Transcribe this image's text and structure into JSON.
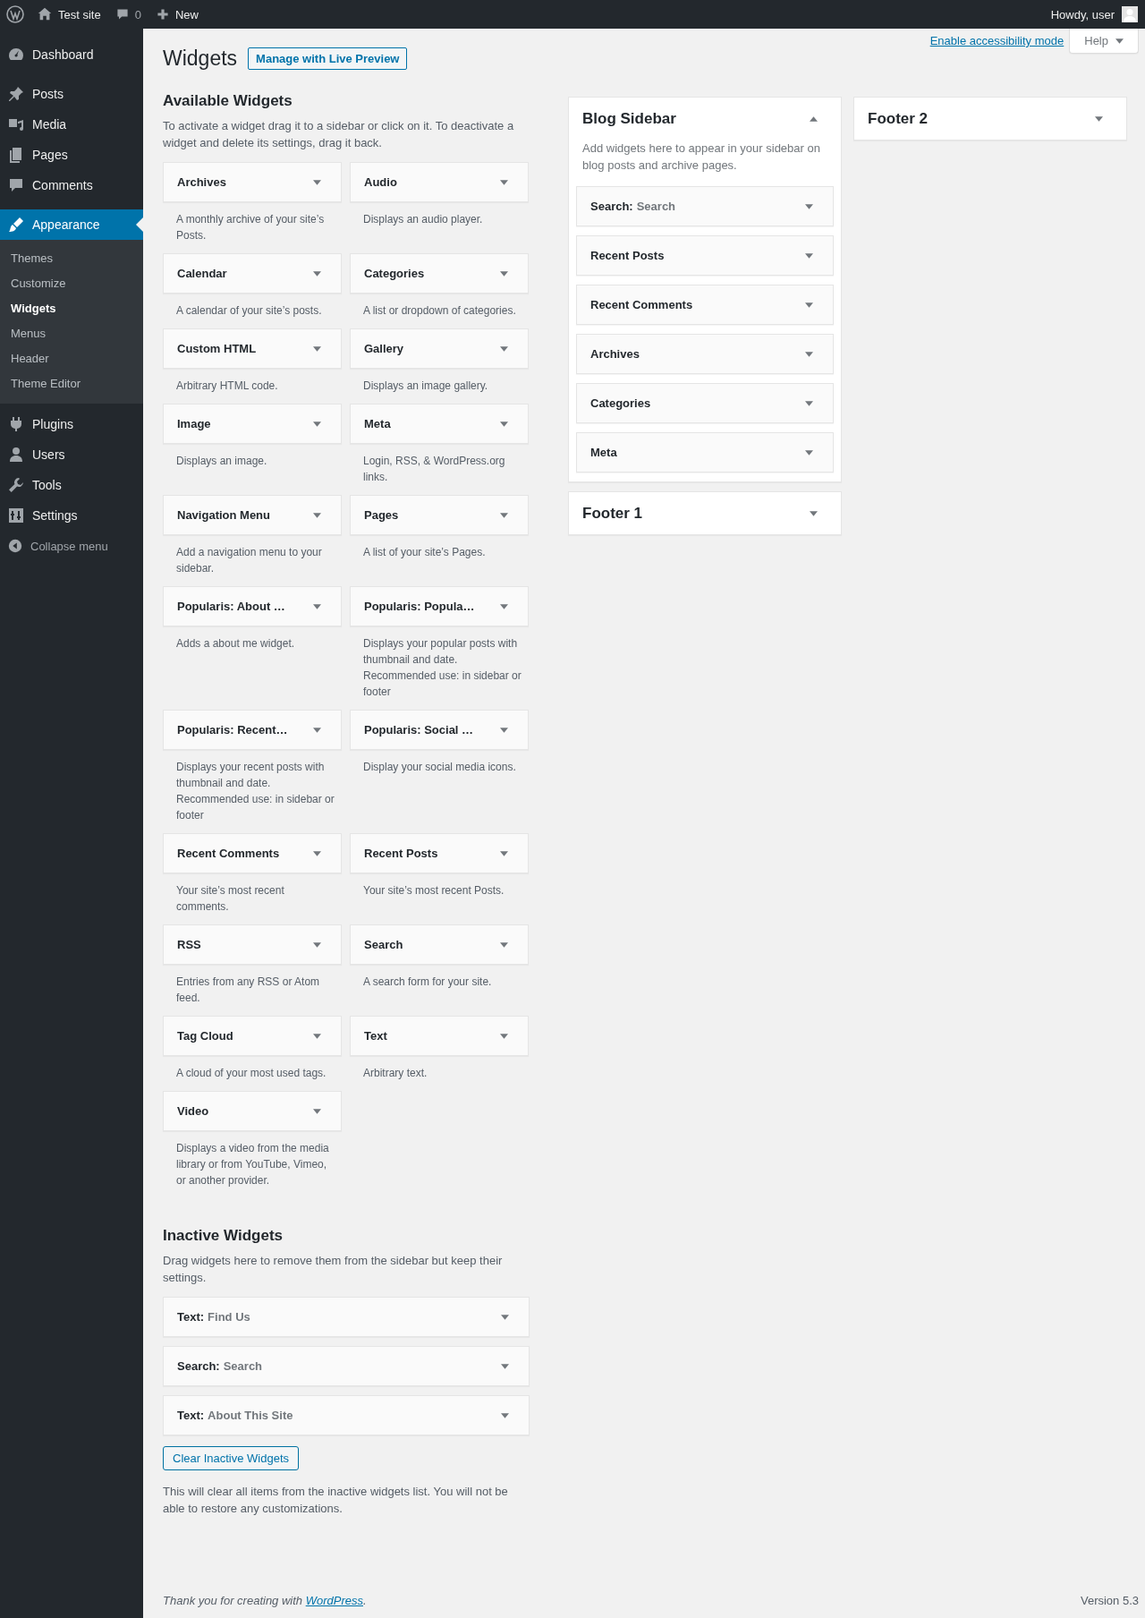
{
  "admin_bar": {
    "site_name": "Test site",
    "comments_count": "0",
    "new_label": "New",
    "greeting": "Howdy, user"
  },
  "menu": [
    {
      "label": "Dashboard",
      "selected": false
    },
    {
      "label": "Posts",
      "selected": false
    },
    {
      "label": "Media",
      "selected": false
    },
    {
      "label": "Pages",
      "selected": false
    },
    {
      "label": "Comments",
      "selected": false
    },
    {
      "label": "Appearance",
      "selected": true,
      "children": [
        {
          "label": "Themes",
          "selected": false
        },
        {
          "label": "Customize",
          "selected": false
        },
        {
          "label": "Widgets",
          "selected": true
        },
        {
          "label": "Menus",
          "selected": false
        },
        {
          "label": "Header",
          "selected": false
        },
        {
          "label": "Theme Editor",
          "selected": false
        }
      ]
    },
    {
      "label": "Plugins",
      "selected": false
    },
    {
      "label": "Users",
      "selected": false
    },
    {
      "label": "Tools",
      "selected": false
    },
    {
      "label": "Settings",
      "selected": false
    }
  ],
  "collapse_label": "Collapse menu",
  "screen_links": {
    "accessibility": "Enable accessibility mode",
    "help": "Help"
  },
  "page": {
    "title": "Widgets",
    "action": "Manage with Live Preview"
  },
  "available": {
    "heading": "Available Widgets",
    "description": "To activate a widget drag it to a sidebar or click on it. To deactivate a widget and delete its settings, drag it back.",
    "widgets": [
      {
        "title": "Archives",
        "description": "A monthly archive of your site’s Posts."
      },
      {
        "title": "Audio",
        "description": "Displays an audio player."
      },
      {
        "title": "Calendar",
        "description": "A calendar of your site’s posts."
      },
      {
        "title": "Categories",
        "description": "A list or dropdown of categories."
      },
      {
        "title": "Custom HTML",
        "description": "Arbitrary HTML code."
      },
      {
        "title": "Gallery",
        "description": "Displays an image gallery."
      },
      {
        "title": "Image",
        "description": "Displays an image."
      },
      {
        "title": "Meta",
        "description": "Login, RSS, & WordPress.org links."
      },
      {
        "title": "Navigation Menu",
        "description": "Add a navigation menu to your sidebar."
      },
      {
        "title": "Pages",
        "description": "A list of your site’s Pages."
      },
      {
        "title": "Popularis: About …",
        "description": "Adds a about me widget."
      },
      {
        "title": "Popularis: Popula…",
        "description": "Displays your popular posts with thumbnail and date. Recommended use: in sidebar or footer"
      },
      {
        "title": "Popularis: Recent…",
        "description": "Displays your recent posts with thumbnail and date. Recommended use: in sidebar or footer"
      },
      {
        "title": "Popularis: Social …",
        "description": "Display your social media icons."
      },
      {
        "title": "Recent Comments",
        "description": "Your site’s most recent comments."
      },
      {
        "title": "Recent Posts",
        "description": "Your site’s most recent Posts."
      },
      {
        "title": "RSS",
        "description": "Entries from any RSS or Atom feed."
      },
      {
        "title": "Search",
        "description": "A search form for your site."
      },
      {
        "title": "Tag Cloud",
        "description": "A cloud of your most used tags."
      },
      {
        "title": "Text",
        "description": "Arbitrary text."
      },
      {
        "title": "Video",
        "description": "Displays a video from the media library or from YouTube, Vimeo, or another provider."
      }
    ]
  },
  "inactive": {
    "heading": "Inactive Widgets",
    "description": "Drag widgets here to remove them from the sidebar but keep their settings.",
    "widgets": [
      {
        "title": "Text:",
        "instance": "Find Us"
      },
      {
        "title": "Search:",
        "instance": "Search"
      },
      {
        "title": "Text:",
        "instance": "About This Site"
      }
    ],
    "clear_button": "Clear Inactive Widgets",
    "note": "This will clear all items from the inactive widgets list. You will not be able to restore any customizations."
  },
  "sidebar_columns": [
    [
      {
        "name": "Blog Sidebar",
        "expanded": true,
        "description": "Add widgets here to appear in your sidebar on blog posts and archive pages.",
        "widgets": [
          {
            "title": "Search:",
            "instance": "Search"
          },
          {
            "title": "Recent Posts"
          },
          {
            "title": "Recent Comments"
          },
          {
            "title": "Archives"
          },
          {
            "title": "Categories"
          },
          {
            "title": "Meta"
          }
        ]
      },
      {
        "name": "Footer 1",
        "expanded": false
      }
    ],
    [
      {
        "name": "Footer 2",
        "expanded": false
      }
    ]
  ],
  "footer": {
    "thanks": "Thank you for creating with ",
    "link": "WordPress",
    "after": ".",
    "version": "Version 5.3"
  }
}
